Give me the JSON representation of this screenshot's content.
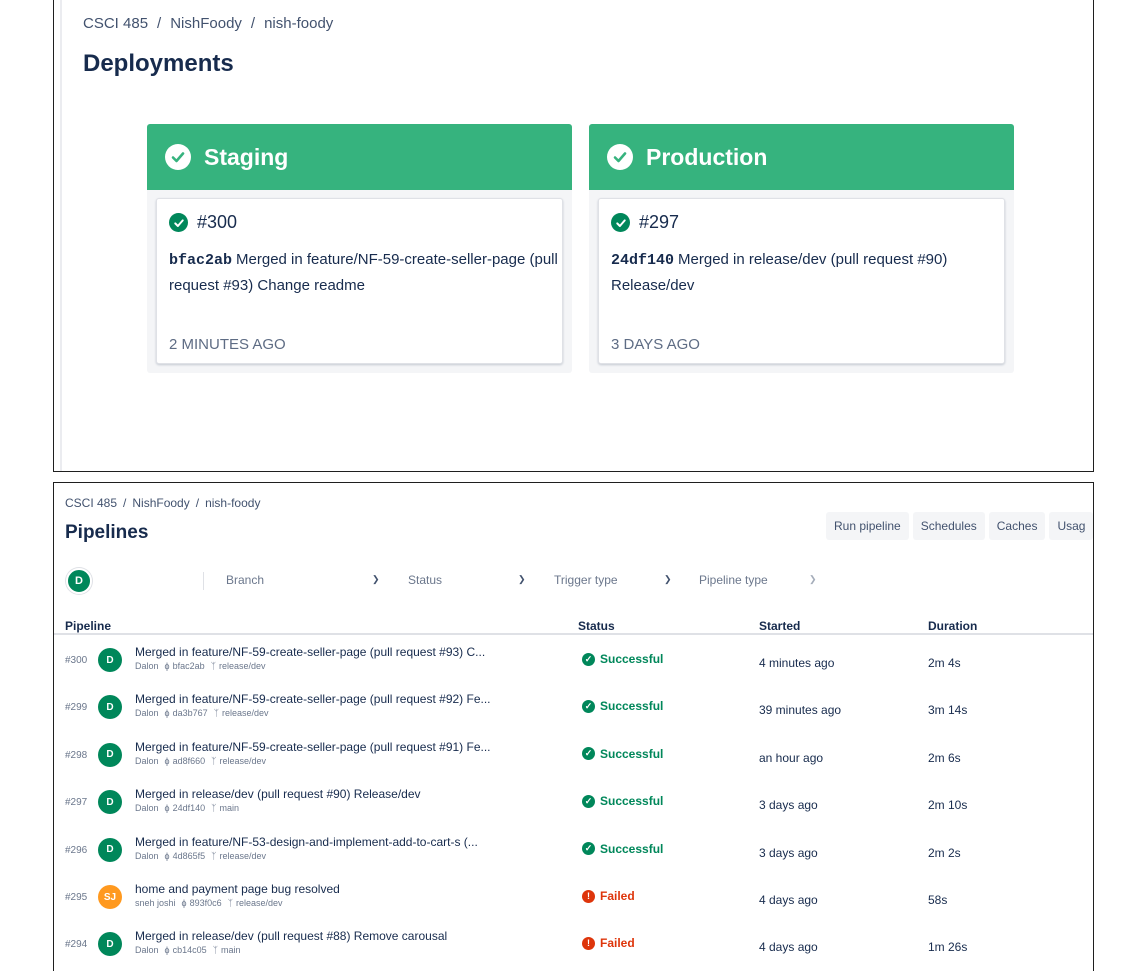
{
  "deployments": {
    "breadcrumb": [
      "CSCI 485",
      "NishFoody",
      "nish-foody"
    ],
    "title": "Deployments",
    "environments": [
      {
        "name": "Staging",
        "build": "#300",
        "hash": "bfac2ab",
        "message": "Merged in feature/NF-59-create-seller-page (pull request #93) Change readme",
        "ago": "2 minutes ago"
      },
      {
        "name": "Production",
        "build": "#297",
        "hash": "24df140",
        "message": "Merged in release/dev (pull request #90) Release/dev",
        "ago": "3 days ago"
      }
    ]
  },
  "pipelines": {
    "breadcrumb": [
      "CSCI 485",
      "NishFoody",
      "nish-foody"
    ],
    "title": "Pipelines",
    "actions": [
      "Run pipeline",
      "Schedules",
      "Caches",
      "Usag"
    ],
    "filters": {
      "user_initial": "D",
      "branch": "Branch",
      "status": "Status",
      "trigger_type": "Trigger type",
      "pipeline_type": "Pipeline type"
    },
    "columns": {
      "pipeline": "Pipeline",
      "status": "Status",
      "started": "Started",
      "duration": "Duration"
    },
    "rows": [
      {
        "num": "#300",
        "initials": "D",
        "avatar_color": "#00875a",
        "message": "Merged in feature/NF-59-create-seller-page (pull request #93) C...",
        "author": "Dalon",
        "commit": "bfac2ab",
        "branch": "release/dev",
        "status": "Successful",
        "started": "4 minutes ago",
        "duration": "2m 4s"
      },
      {
        "num": "#299",
        "initials": "D",
        "avatar_color": "#00875a",
        "message": "Merged in feature/NF-59-create-seller-page (pull request #92) Fe...",
        "author": "Dalon",
        "commit": "da3b767",
        "branch": "release/dev",
        "status": "Successful",
        "started": "39 minutes ago",
        "duration": "3m 14s"
      },
      {
        "num": "#298",
        "initials": "D",
        "avatar_color": "#00875a",
        "message": "Merged in feature/NF-59-create-seller-page (pull request #91) Fe...",
        "author": "Dalon",
        "commit": "ad8f660",
        "branch": "release/dev",
        "status": "Successful",
        "started": "an hour ago",
        "duration": "2m 6s"
      },
      {
        "num": "#297",
        "initials": "D",
        "avatar_color": "#00875a",
        "message": "Merged in release/dev (pull request #90) Release/dev",
        "author": "Dalon",
        "commit": "24df140",
        "branch": "main",
        "status": "Successful",
        "started": "3 days ago",
        "duration": "2m 10s"
      },
      {
        "num": "#296",
        "initials": "D",
        "avatar_color": "#00875a",
        "message": "Merged in feature/NF-53-design-and-implement-add-to-cart-s (...",
        "author": "Dalon",
        "commit": "4d865f5",
        "branch": "release/dev",
        "status": "Successful",
        "started": "3 days ago",
        "duration": "2m 2s"
      },
      {
        "num": "#295",
        "initials": "SJ",
        "avatar_color": "#ff991f",
        "message": "home and payment page bug resolved",
        "author": "sneh joshi",
        "commit": "893f0c6",
        "branch": "release/dev",
        "status": "Failed",
        "started": "4 days ago",
        "duration": "58s"
      },
      {
        "num": "#294",
        "initials": "D",
        "avatar_color": "#00875a",
        "message": "Merged in release/dev (pull request #88) Remove carousal",
        "author": "Dalon",
        "commit": "cb14c05",
        "branch": "main",
        "status": "Failed",
        "started": "4 days ago",
        "duration": "1m 26s"
      }
    ]
  },
  "colors": {
    "success": "#00875a",
    "failed": "#de350b",
    "env_header": "#36b37e"
  }
}
